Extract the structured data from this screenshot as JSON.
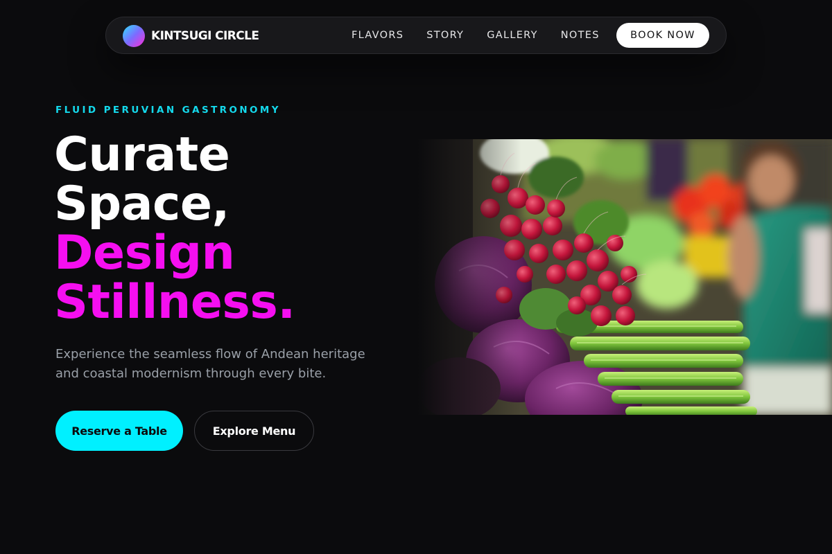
{
  "brand": {
    "name": "KINTSUGI CIRCLE",
    "icon": "gradient-circle-logo"
  },
  "nav": {
    "links": [
      "FLAVORS",
      "STORY",
      "GALLERY",
      "NOTES"
    ],
    "cta": "BOOK NOW"
  },
  "hero": {
    "eyebrow": "FLUID PERUVIAN GASTRONOMY",
    "headline": {
      "line1": "Curate",
      "line2": "Space,",
      "line3": "Design",
      "line4": "Stillness",
      "line4_punct": "."
    },
    "subtext": "Experience the seamless flow of Andean heritage and coastal modernism through every bite.",
    "primary_button": "Reserve a Table",
    "secondary_button": "Explore Menu"
  },
  "colors": {
    "background": "#0b0b0d",
    "accent_cyan": "#00f0ff",
    "accent_magenta": "#f50ff0",
    "eyebrow": "#14d9ec"
  }
}
